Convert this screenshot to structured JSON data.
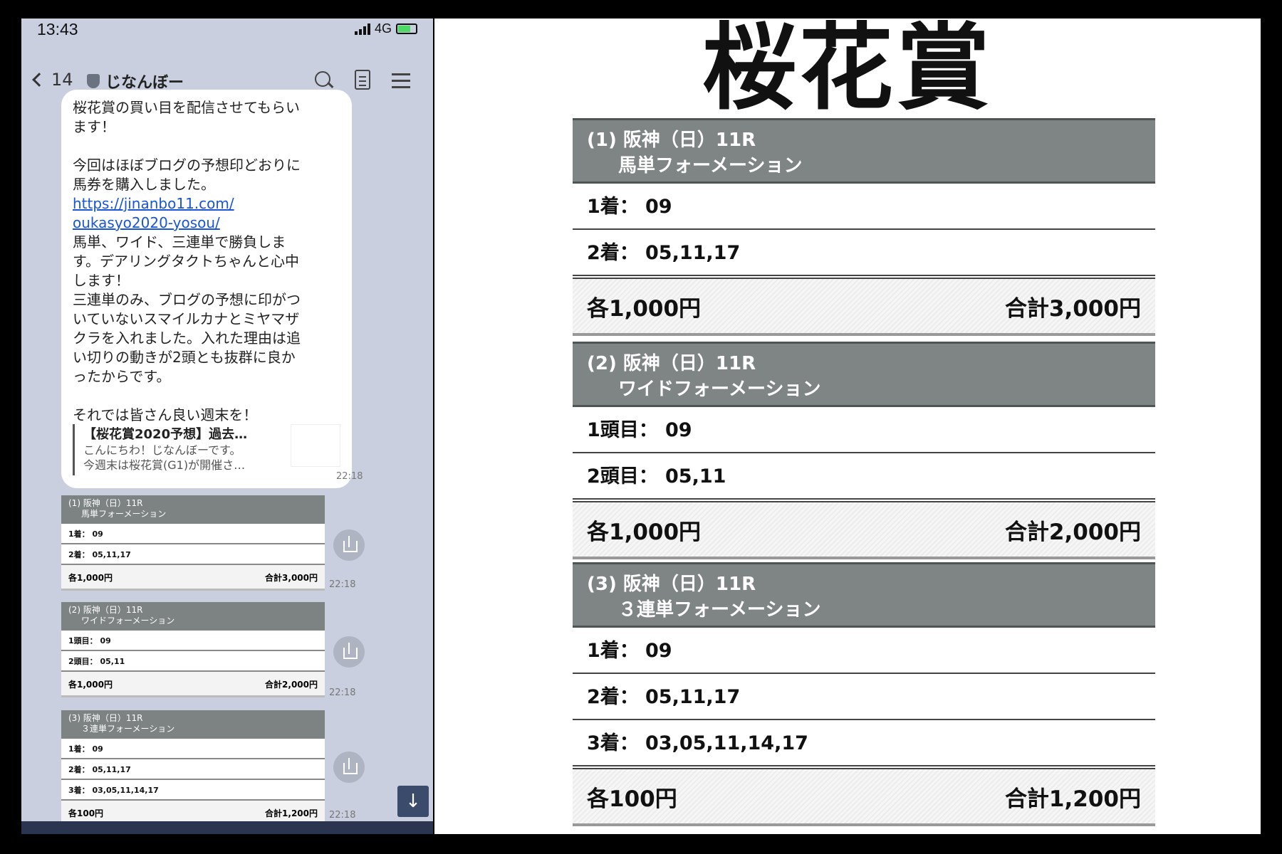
{
  "status": {
    "time": "13:43",
    "network": "4G"
  },
  "chat": {
    "unread": "14",
    "name": "じなんぼー",
    "message": {
      "line1": "桜花賞の買い目を配信させてもらい",
      "line2": "ます！",
      "line3": "今回はほぼブログの予想印どおりに",
      "line4": "馬券を購入しました。",
      "link1": "https://jinanbo11.com/",
      "link2": "oukasyo2020-yosou/",
      "line5": "馬単、ワイド、三連単で勝負しま",
      "line6": "す。デアリングタクトちゃんと心中",
      "line7": "します！",
      "line8": "三連単のみ、ブログの予想に印がつ",
      "line9": "いていないスマイルカナとミヤマザ",
      "line10": "クラを入れました。入れた理由は追",
      "line11": "い切りの動きが2頭とも抜群に良か",
      "line12": "ったからです。",
      "line13": "それでは皆さん良い週末を！"
    },
    "preview": {
      "title": "【桜花賞2020予想】過去…",
      "desc1": "こんにちわ！じなんぼーです。",
      "desc2": "今週末は桜花賞(G1)が開催さ…"
    },
    "time": "22:18"
  },
  "panel": {
    "title": "桜花賞",
    "sections": [
      {
        "head1": "(1) 阪神（日）11R",
        "head2": "馬単フォーメーション",
        "rows": [
          {
            "key": "1着：",
            "value": "09"
          },
          {
            "key": "2着：",
            "value": "05,11,17"
          }
        ],
        "each": "各1,000円",
        "total": "合計3,000円"
      },
      {
        "head1": "(2) 阪神（日）11R",
        "head2": "ワイドフォーメーション",
        "rows": [
          {
            "key": "1頭目：",
            "value": "09"
          },
          {
            "key": "2頭目：",
            "value": "05,11"
          }
        ],
        "each": "各1,000円",
        "total": "合計2,000円"
      },
      {
        "head1": "(3) 阪神（日）11R",
        "head2": "３連単フォーメーション",
        "rows": [
          {
            "key": "1着：",
            "value": "09"
          },
          {
            "key": "2着：",
            "value": "05,11,17"
          },
          {
            "key": "3着：",
            "value": "03,05,11,14,17"
          }
        ],
        "each": "各100円",
        "total": "合計1,200円"
      }
    ]
  }
}
